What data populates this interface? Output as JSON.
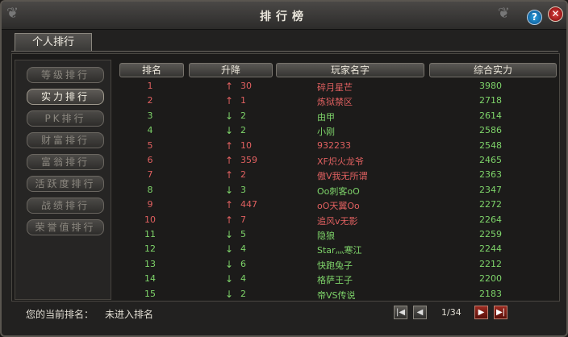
{
  "window": {
    "title": "排行榜",
    "help_icon": "question-icon",
    "close_icon": "close-icon",
    "colors": {
      "up": "#e06060",
      "down": "#7ed46a"
    }
  },
  "tabs": [
    {
      "label": "个人排行",
      "active": true
    }
  ],
  "sidebar": {
    "items": [
      {
        "label": "等级排行",
        "active": false
      },
      {
        "label": "实力排行",
        "active": true
      },
      {
        "label": "PK排行",
        "active": false
      },
      {
        "label": "财富排行",
        "active": false
      },
      {
        "label": "富翁排行",
        "active": false
      },
      {
        "label": "活跃度排行",
        "active": false
      },
      {
        "label": "战绩排行",
        "active": false
      },
      {
        "label": "荣誉值排行",
        "active": false
      }
    ]
  },
  "table": {
    "headers": [
      "排名",
      "升降",
      "玩家名字",
      "综合实力"
    ],
    "rows": [
      {
        "rank": "1",
        "dir": "up",
        "delta": "30",
        "name": "碎月星芒",
        "power": "3980"
      },
      {
        "rank": "2",
        "dir": "up",
        "delta": "1",
        "name": "炼狱禁区",
        "power": "2718"
      },
      {
        "rank": "3",
        "dir": "down",
        "delta": "2",
        "name": "由甲",
        "power": "2614"
      },
      {
        "rank": "4",
        "dir": "down",
        "delta": "2",
        "name": "小刚",
        "power": "2586"
      },
      {
        "rank": "5",
        "dir": "up",
        "delta": "10",
        "name": "932233",
        "power": "2548"
      },
      {
        "rank": "6",
        "dir": "up",
        "delta": "359",
        "name": "XF炽火龙爷",
        "power": "2465"
      },
      {
        "rank": "7",
        "dir": "up",
        "delta": "2",
        "name": "傲V我无所谓",
        "power": "2363"
      },
      {
        "rank": "8",
        "dir": "down",
        "delta": "3",
        "name": "Oo刺客oO",
        "power": "2347"
      },
      {
        "rank": "9",
        "dir": "up",
        "delta": "447",
        "name": "oO天翼Oo",
        "power": "2272"
      },
      {
        "rank": "10",
        "dir": "up",
        "delta": "7",
        "name": "追风v无影",
        "power": "2264"
      },
      {
        "rank": "11",
        "dir": "down",
        "delta": "5",
        "name": "隐狼",
        "power": "2259"
      },
      {
        "rank": "12",
        "dir": "down",
        "delta": "4",
        "name": "Star灬寒江",
        "power": "2244"
      },
      {
        "rank": "13",
        "dir": "down",
        "delta": "6",
        "name": "快跑兔子",
        "power": "2212"
      },
      {
        "rank": "14",
        "dir": "down",
        "delta": "4",
        "name": "格萨王子",
        "power": "2200"
      },
      {
        "rank": "15",
        "dir": "down",
        "delta": "2",
        "name": "帝VS传说",
        "power": "2183"
      }
    ]
  },
  "footer": {
    "my_rank_label": "您的当前排名：",
    "my_rank_value": "未进入排名",
    "page": "1/34",
    "icons": {
      "first": "first-page-icon",
      "prev": "prev-page-icon",
      "next": "next-page-icon",
      "last": "last-page-icon"
    }
  }
}
